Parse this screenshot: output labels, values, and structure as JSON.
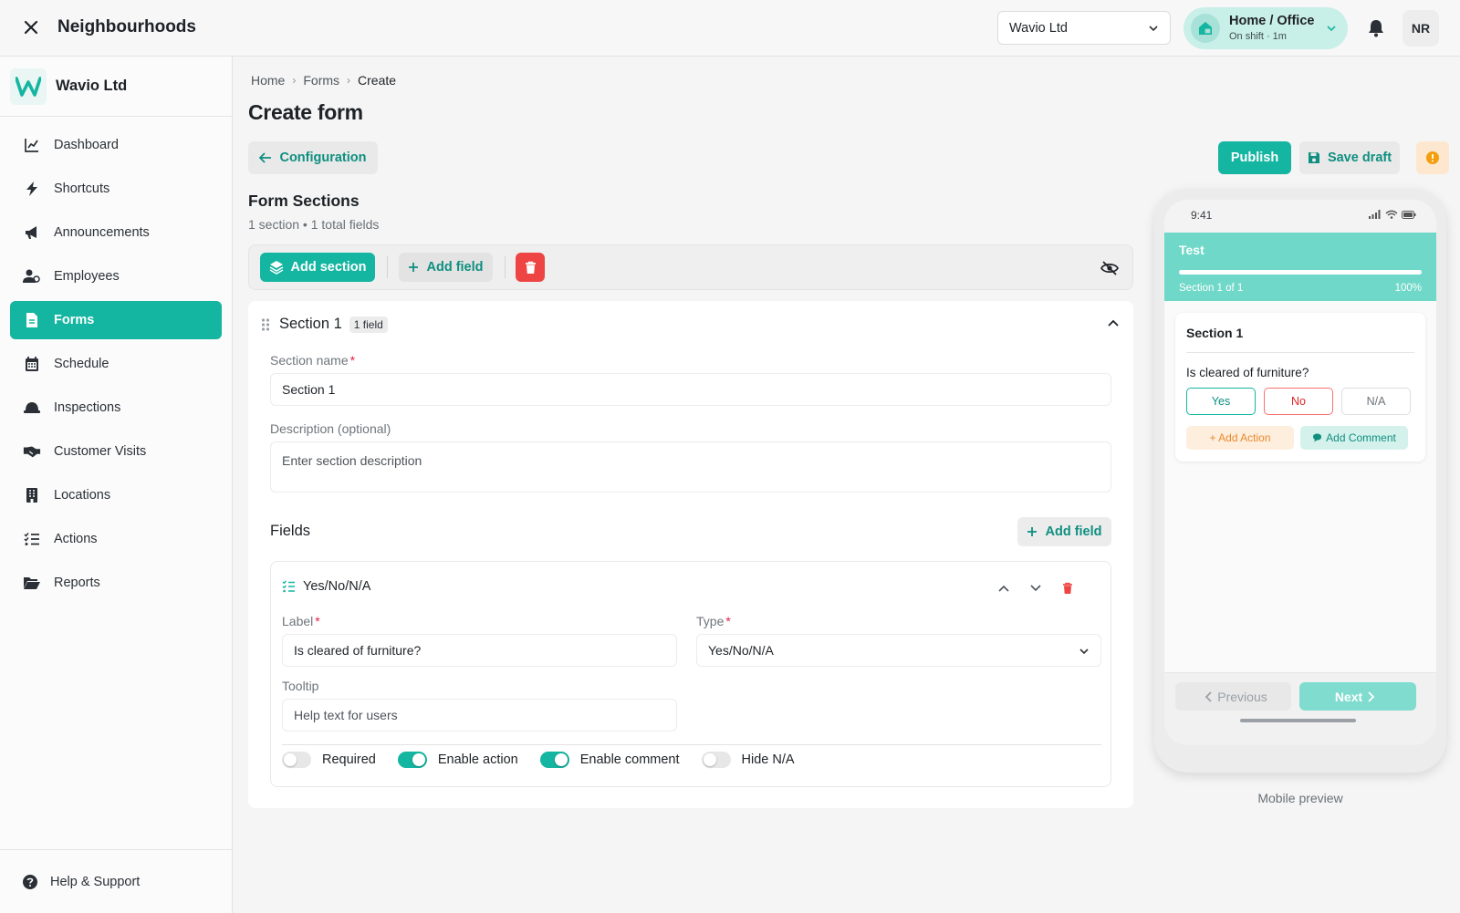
{
  "topbar": {
    "title": "Neighbourhoods",
    "org_select": "Wavio Ltd",
    "shift": {
      "title": "Home / Office",
      "subtitle": "On shift · 1m"
    },
    "avatar_initials": "NR"
  },
  "sidebar": {
    "org_name": "Wavio Ltd",
    "items": [
      {
        "label": "Dashboard",
        "icon": "chart-line-icon"
      },
      {
        "label": "Shortcuts",
        "icon": "lightning-icon"
      },
      {
        "label": "Announcements",
        "icon": "megaphone-icon"
      },
      {
        "label": "Employees",
        "icon": "users-icon"
      },
      {
        "label": "Forms",
        "icon": "file-icon",
        "active": true
      },
      {
        "label": "Schedule",
        "icon": "calendar-icon"
      },
      {
        "label": "Inspections",
        "icon": "hard-hat-icon"
      },
      {
        "label": "Customer Visits",
        "icon": "handshake-icon"
      },
      {
        "label": "Locations",
        "icon": "building-icon"
      },
      {
        "label": "Actions",
        "icon": "list-check-icon"
      },
      {
        "label": "Reports",
        "icon": "folder-open-icon"
      }
    ],
    "help_label": "Help & Support"
  },
  "breadcrumb": {
    "home": "Home",
    "forms": "Forms",
    "current": "Create"
  },
  "page_title": "Create form",
  "buttons": {
    "configuration": "Configuration",
    "publish": "Publish",
    "save_draft": "Save draft"
  },
  "form_sections": {
    "heading": "Form Sections",
    "meta": "1 section • 1 total fields",
    "add_section": "Add section",
    "add_field": "Add field"
  },
  "section": {
    "title": "Section 1",
    "badge": "1 field",
    "name_label": "Section name",
    "name_value": "Section 1",
    "desc_label": "Description (optional)",
    "desc_placeholder": "Enter section description",
    "fields_title": "Fields",
    "add_field": "Add field"
  },
  "field": {
    "type_name": "Yes/No/N/A",
    "label_label": "Label",
    "label_value": "Is cleared of furniture?",
    "type_label": "Type",
    "type_value": "Yes/No/N/A",
    "tooltip_label": "Tooltip",
    "tooltip_placeholder": "Help text for users",
    "toggles": [
      {
        "label": "Required",
        "on": false
      },
      {
        "label": "Enable action",
        "on": true
      },
      {
        "label": "Enable comment",
        "on": true
      },
      {
        "label": "Hide N/A",
        "on": false
      }
    ]
  },
  "preview": {
    "time": "9:41",
    "form_title": "Test",
    "progress_text": "Section 1 of 1",
    "progress_pct": "100%",
    "progress_value": 1.0,
    "section_title": "Section 1",
    "question": "Is cleared of furniture?",
    "options": [
      "Yes",
      "No",
      "N/A"
    ],
    "add_action": "+ Add Action",
    "add_comment": "Add Comment",
    "prev": "Previous",
    "next": "Next",
    "caption": "Mobile preview"
  },
  "colors": {
    "accent": "#14b5a1",
    "danger": "#ef4444",
    "warning": "#f59e0b"
  }
}
